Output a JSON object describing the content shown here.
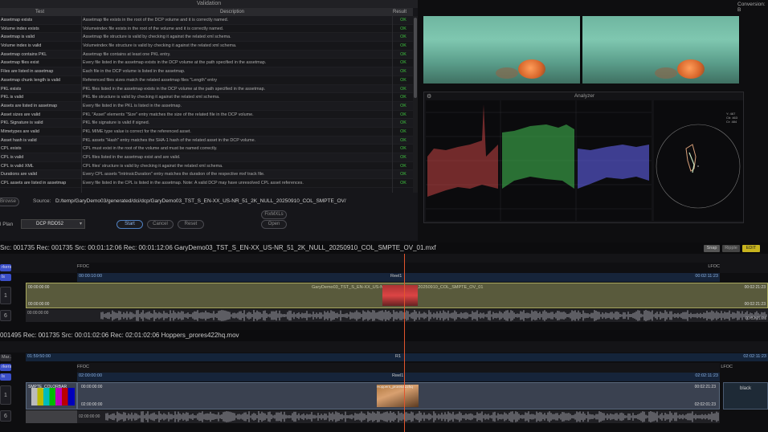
{
  "validation": {
    "title": "Validation",
    "columns": {
      "test": "Test",
      "description": "Description",
      "result": "Result"
    },
    "rows": [
      {
        "test": "Assetmap exists",
        "description": "Assetmap file exists in the root of the DCP volume and it is correctly named.",
        "result": "OK"
      },
      {
        "test": "Volume index exists",
        "description": "Volumeindex file exists in the root of the volume and it is correctly named.",
        "result": "OK"
      },
      {
        "test": "Assetmap is valid",
        "description": "Assetmap file structure is valid by checking it against the related xml schema.",
        "result": "OK"
      },
      {
        "test": "Volume index is valid",
        "description": "Volumeindex file structure is valid by checking it against the related xml schema.",
        "result": "OK"
      },
      {
        "test": "Assetmap contains PKL",
        "description": "Assetmap file contains at least one PKL entry.",
        "result": "OK"
      },
      {
        "test": "Assetmap files exist",
        "description": "Every file listed in the assetmap exists in the DCP volume at the path specified in the assetmap.",
        "result": "OK"
      },
      {
        "test": "Files are listed in assetmap",
        "description": "Each file in the DCP volume is listed in the assetmap.",
        "result": "OK"
      },
      {
        "test": "Assetmap chunk length is valid",
        "description": "Referenced files sizes match the related assetmap files \"Length\" entry",
        "result": "OK"
      },
      {
        "test": "PKL exists",
        "description": "PKL files listed in the assetmap exists in the DCP volume at the path specified in the assetmap.",
        "result": "OK"
      },
      {
        "test": "PKL is valid",
        "description": "PKL file structure is valid by checking it against the related xml schema.",
        "result": "OK"
      },
      {
        "test": "Assets are listed in assetmap",
        "description": "Every file listed in the PKL is listed in the assetmap.",
        "result": "OK"
      },
      {
        "test": "Asset sizes are valid",
        "description": "PKL \"Asset\" elements \"Size\" entry matches the size of the related file in the DCP volume.",
        "result": "OK"
      },
      {
        "test": "PKL Signature is valid",
        "description": "PKL file signature is valid if signed.",
        "result": "OK"
      },
      {
        "test": "Mimetypes are valid",
        "description": "PKL MIME type value is correct for the referenced asset.",
        "result": "OK"
      },
      {
        "test": "Asset hash is valid",
        "description": "PKL assets \"Hash\" entry matches the SHA-1 hash of the related asset in the DCP volume.",
        "result": "OK"
      },
      {
        "test": "CPL exists",
        "description": "CPL must exist in the root of the volume and must be named correctly.",
        "result": "OK"
      },
      {
        "test": "CPL is valid",
        "description": "CPL files listed in the assetmap exist and are valid.",
        "result": "OK"
      },
      {
        "test": "CPL is valid XML",
        "description": "CPL files' structure is valid by checking it against the related xml schema.",
        "result": "OK"
      },
      {
        "test": "Durations are valid",
        "description": "Every CPL assets \"IntrinsicDuration\" entry matches the duration of the respective mxf track file.",
        "result": "OK"
      },
      {
        "test": "CPL assets are listed in assetmap",
        "description": "Every file listed in the CPL is listed in the assetmap. Note: A valid DCP may have unresolved CPL asset references.",
        "result": "OK"
      }
    ],
    "browse_label": "Browse",
    "source_label": "Source:",
    "source_path": "D:/temp/GaryDemo03/generated/dci/dcp/GaryDemo03_TST_S_EN-XX_US-NR_51_2K_NULL_20250910_COL_SMPTE_OV/",
    "plan_label": "l Plan",
    "plan_value": "DCP RDD52",
    "start_label": "Start",
    "cancel_label": "Cancel",
    "reset_label": "Reset",
    "fixmxls_label": "FixMXLs",
    "open_label": "Open"
  },
  "conversion_label": "Conversion: B",
  "analyzer": {
    "title": "Analyzer",
    "vector_labels": [
      "Y: 467",
      "Cb: 463",
      "Cr: 484"
    ]
  },
  "timeline1": {
    "src_readout": "Src:  001735   Rec:  001735    Src:  00:01:12:06    Rec:  00:01:12:06    GaryDemo03_TST_S_EN-XX_US-NR_51_2K_NULL_20250910_COL_SMPTE_OV_01.mxf",
    "tags": {
      "snap": "Snap",
      "ripple": "Ripple",
      "edit": "EDIT"
    },
    "markers_label": "rkers",
    "ls_label": "ls",
    "ffoc": "FFOC",
    "lfoc": "LFOC",
    "reel": "Reel1",
    "tc_start": "00:00:10:00",
    "tc_end": "00:02:11:23",
    "clip_name": "GaryDemo03_TST_S_EN-XX_US-NR_51_2K_NULL_20250910_COL_SMPTE_OV_01",
    "clip_tc_in": "00:00:00:00",
    "clip_tc_in2": "00:00:00:00",
    "clip_tc_out": "00:02:21:23",
    "clip_tc_out2": "00:02:21:23",
    "audio_tc_in": "00:00:00:00",
    "audio_tc_out": "00:02:21:23",
    "track_v": "1",
    "track_a": "6"
  },
  "timeline2": {
    "src_readout": "001495   Rec:  001735    Src:  00:01:02:06    Rec:  02:01:02:06    Hoppers_prores422hq.mov",
    "markers_label": "Mar...",
    "markers2_label": "rkers",
    "ls_label": "ls",
    "r1": "R1",
    "tc_left": "01:59:50:00",
    "tc_right": "02:02:11:23",
    "ffoc": "FFOC",
    "lfoc": "LFOC",
    "reel": "Reel1",
    "tc_start": "02:00:00:00",
    "tc_end": "02:02:11:23",
    "colorbar_name": "SMPTE_COLORBAR",
    "clip_tc_in": "00:00:00:00",
    "clip_tc_in2": "02:00:00:00",
    "clip_tc_out": "00:02:21:23",
    "clip_tc_out2": "02:02:01:23",
    "clip_mid_label": "Hoppers_prores422hq",
    "black_label": "black",
    "audio_tc_in": "02:00:00:00",
    "track_v": "1",
    "track_a": "6"
  }
}
